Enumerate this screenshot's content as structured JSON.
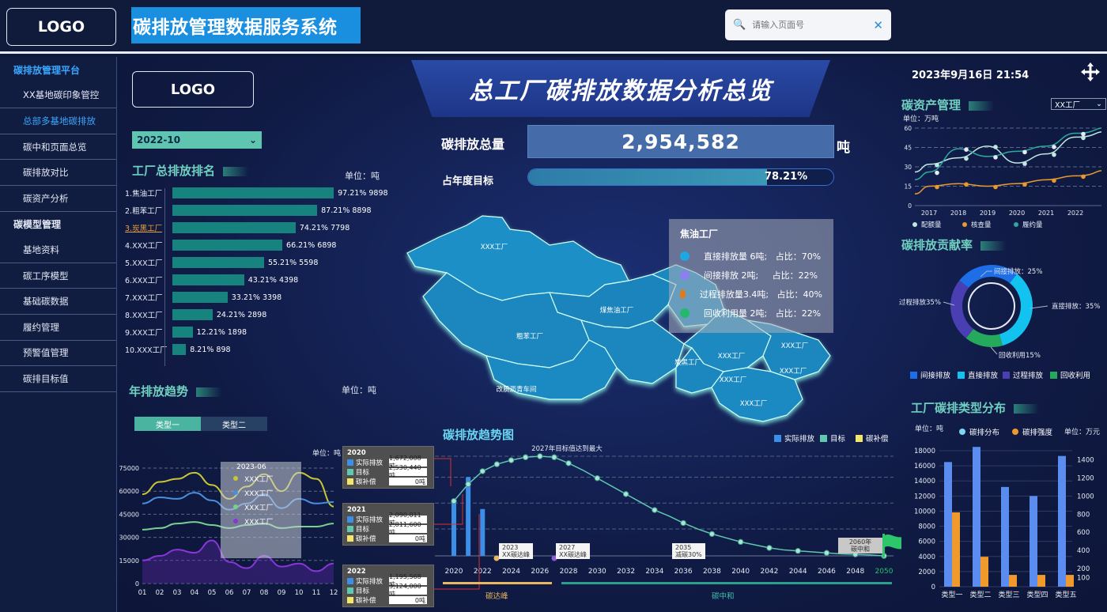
{
  "header": {
    "logo": "LOGO",
    "system_title": "碳排放管理数据服务系统",
    "search_placeholder": "请输入页面号"
  },
  "sidebar": {
    "items": [
      {
        "label": "碳排放管理平台",
        "type": "head-active"
      },
      {
        "label": "XX基地碳印象管控",
        "type": "item"
      },
      {
        "label": "总部多基地碳排放",
        "type": "active"
      },
      {
        "label": "碳中和页面总览",
        "type": "item"
      },
      {
        "label": "碳排放对比",
        "type": "item"
      },
      {
        "label": "碳资产分析",
        "type": "item"
      },
      {
        "label": "碳模型管理",
        "type": "head"
      },
      {
        "label": "基地资料",
        "type": "item"
      },
      {
        "label": "碳工序模型",
        "type": "item"
      },
      {
        "label": "基础碳数据",
        "type": "item"
      },
      {
        "label": "履约管理",
        "type": "item"
      },
      {
        "label": "预警值管理",
        "type": "item"
      },
      {
        "label": "碳排目标值",
        "type": "item"
      }
    ]
  },
  "main": {
    "logo": "LOGO",
    "page_title": "总工厂碳排放数据分析总览",
    "date_select": "2022-10",
    "datetime": "2023年9月16日 21:54",
    "total_label": "碳排放总量",
    "total_value": "2,954,582",
    "total_unit": "吨",
    "target_label": "占年度目标",
    "target_percent_text": "78.21%",
    "target_fraction": 0.7821
  },
  "ranking": {
    "title": "工厂总排放排名",
    "unit": "单位：吨",
    "rows": [
      {
        "name": "1.焦油工厂",
        "percent": 97.21,
        "value": "97.21% 9898",
        "highlight": false
      },
      {
        "name": "2.粗苯工厂",
        "percent": 87.21,
        "value": "87.21% 8898",
        "highlight": false
      },
      {
        "name": "3.炭黑工厂",
        "percent": 74.21,
        "value": "74.21% 7798",
        "highlight": true
      },
      {
        "name": "4.XXX工厂",
        "percent": 66.21,
        "value": "66.21% 6898",
        "highlight": false
      },
      {
        "name": "5.XXX工厂",
        "percent": 55.21,
        "value": "55.21% 5598",
        "highlight": false
      },
      {
        "name": "6.XXX工厂",
        "percent": 43.21,
        "value": "43.21% 4398",
        "highlight": false
      },
      {
        "name": "7.XXX工厂",
        "percent": 33.21,
        "value": "33.21% 3398",
        "highlight": false
      },
      {
        "name": "8.XXX工厂",
        "percent": 24.21,
        "value": "24.21% 2898",
        "highlight": false
      },
      {
        "name": "9.XXX工厂",
        "percent": 12.21,
        "value": "12.21% 1898",
        "highlight": false
      },
      {
        "name": "10.XXX工厂",
        "percent": 8.21,
        "value": "8.21% 898",
        "highlight": false
      }
    ]
  },
  "annual_trend": {
    "title": "年排放趋势",
    "unit": "单位：吨",
    "tabs": [
      "类型一",
      "类型二"
    ],
    "unit_small": "单位：吨",
    "tooltip": {
      "month": "2023-06",
      "items": [
        "XXX工厂",
        "XXX工厂",
        "XXX工厂",
        "XXX工厂"
      ]
    },
    "chart_data": {
      "type": "line",
      "categories": [
        "01",
        "02",
        "03",
        "04",
        "05",
        "06",
        "07",
        "08",
        "09",
        "10",
        "11",
        "12"
      ],
      "yticks": [
        0,
        15000,
        30000,
        45000,
        60000,
        75000
      ],
      "ylim": [
        0,
        75000
      ],
      "series": [
        {
          "color": "#c8c635",
          "values": [
            58000,
            66000,
            68000,
            72000,
            64000,
            55000,
            63000,
            71000,
            60000,
            72000,
            68000,
            50000
          ]
        },
        {
          "color": "#4a8ee0",
          "values": [
            52000,
            56000,
            55000,
            59000,
            54000,
            48000,
            52000,
            58000,
            49000,
            55000,
            52000,
            53000
          ]
        },
        {
          "color": "#78d090",
          "values": [
            35000,
            36000,
            39000,
            40000,
            38000,
            36000,
            38000,
            39000,
            36000,
            37000,
            37000,
            39000
          ]
        },
        {
          "color": "#8a35d8",
          "values": [
            15000,
            18000,
            22000,
            20000,
            28000,
            14000,
            10000,
            18000,
            11000,
            13000,
            8000,
            13000
          ]
        }
      ]
    }
  },
  "map": {
    "regions": [
      "XXX工厂",
      "煤焦油工厂",
      "粗苯工厂",
      "炭黑工厂",
      "改质沥青车间",
      "XXX工厂",
      "XXX工厂",
      "XXX工厂",
      "XXX工厂",
      "XXX工厂"
    ],
    "tooltip": {
      "title": "焦油工厂",
      "rows": [
        {
          "label": "直接排放量 6吨;   占比：70%",
          "color": "#1ea7e0"
        },
        {
          "label": "间接排放 2吨;     占比：22%",
          "color": "#8c7ff0"
        },
        {
          "label": "过程排放量3.4吨;   占比：40%",
          "color": "#e07a1a"
        },
        {
          "label": "回收利用量 2吨;   占比：22%",
          "color": "#25b96d"
        }
      ]
    }
  },
  "trend_chart": {
    "title": "碳排放趋势图",
    "legend": [
      "实际排放",
      "目标",
      "碳补偿"
    ],
    "peak_note": "2027年目标值达到最大",
    "notes": [
      "2023\nXX碳达峰",
      "2027\nXX碳达峰",
      "2035\n减碳30%",
      "2060年\n碳中和"
    ],
    "phase_labels": [
      "碳达峰",
      "碳中和"
    ],
    "year_boxes": [
      {
        "year": "2020",
        "actual": "1,672,008吨",
        "target": "2,530,440吨",
        "comp": "0吨"
      },
      {
        "year": "2021",
        "actual": "2,090,011吨",
        "target": "2,811,600吨",
        "comp": "0吨"
      },
      {
        "year": "2022",
        "actual": "1,195,568吨",
        "target": "3,124,000吨",
        "comp": "0吨"
      }
    ],
    "row_labels": [
      "实际排放",
      "目标",
      "碳补偿"
    ],
    "chart_data": {
      "type": "line",
      "x": [
        2020,
        2021,
        2022,
        2023,
        2024,
        2025,
        2026,
        2027,
        2028,
        2029,
        2030,
        2031,
        2032,
        2033,
        2034,
        2035,
        2036,
        2037,
        2038,
        2039,
        2040,
        2041,
        2042,
        2043,
        2044,
        2045,
        2046,
        2047,
        2048,
        2049,
        2050
      ],
      "xticks": [
        "2020",
        "2022",
        "2024",
        "2026",
        "2028",
        "2030",
        "2032",
        "2034",
        "2036",
        "2038",
        "2040",
        "2042",
        "2044",
        "2046",
        "2048",
        "2050"
      ],
      "target_values": [
        0.55,
        0.72,
        0.85,
        0.92,
        0.96,
        0.99,
        1.0,
        0.99,
        0.93,
        0.86,
        0.78,
        0.7,
        0.62,
        0.54,
        0.46,
        0.4,
        0.33,
        0.27,
        0.22,
        0.18,
        0.14,
        0.11,
        0.08,
        0.06,
        0.05,
        0.04,
        0.03,
        0.02,
        0.015,
        0.01,
        0.0
      ],
      "actual_bars": [
        {
          "year": 2020,
          "value": 0.53
        },
        {
          "year": 2021,
          "value": 0.79
        },
        {
          "year": 2022,
          "value": 0.47
        }
      ]
    }
  },
  "assets": {
    "title": "碳资产管理",
    "unit": "单位：万吨",
    "select": "XX工厂",
    "legend": [
      "配额量",
      "核查量",
      "履约量"
    ],
    "chart_data": {
      "type": "line",
      "x": [
        "2017",
        "2018",
        "2019",
        "2020",
        "2021",
        "2022"
      ],
      "yticks": [
        0,
        15,
        30,
        45,
        60
      ],
      "ylim": [
        0,
        60
      ],
      "series": [
        {
          "name": "配额量",
          "color": "#bfe8e0",
          "values": [
            32,
            37,
            46,
            33,
            40,
            53
          ]
        },
        {
          "name": "核查量",
          "color": "#e89a2e",
          "values": [
            15,
            17,
            15,
            17,
            20,
            23
          ]
        },
        {
          "name": "履约量",
          "color": "#2ea89e",
          "values": [
            26,
            44,
            38,
            42,
            46,
            56
          ]
        }
      ]
    }
  },
  "contribution": {
    "title": "碳排放贡献率",
    "labels": [
      "间接排放：25%",
      "直接排放：35%",
      "回收利用15%",
      "过程排放35%"
    ],
    "legend": [
      "间接排放",
      "直接排放",
      "过程排放",
      "回收利用"
    ],
    "chart_data": {
      "type": "pie",
      "slices": [
        {
          "name": "间接排放",
          "value": 25,
          "color": "#1e6ee8"
        },
        {
          "name": "直接排放",
          "value": 35,
          "color": "#12c3f0"
        },
        {
          "name": "回收利用",
          "value": 15,
          "color": "#25a95d"
        },
        {
          "name": "过程排放",
          "value": 25,
          "color": "#4a3fb2"
        }
      ]
    }
  },
  "types": {
    "title": "工厂碳排类型分布",
    "unit_left": "单位：吨",
    "unit_right": "单位：万元",
    "legend": [
      "碳排分布",
      "碳排强度"
    ],
    "chart_data": {
      "type": "bar",
      "categories": [
        "类型一",
        "类型二",
        "类型三",
        "类型四",
        "类型五"
      ],
      "yticks_left": [
        0,
        2000,
        4000,
        6000,
        8000,
        10000,
        12000,
        14000,
        16000,
        18000
      ],
      "yticks_right": [
        100,
        200,
        400,
        600,
        800,
        1000,
        1200,
        1400
      ],
      "series": [
        {
          "name": "碳排分布",
          "color": "#5b8cf0",
          "values": [
            16500,
            18500,
            13200,
            12000,
            17300
          ]
        },
        {
          "name": "碳排强度",
          "color": "#f09a2e",
          "values": [
            820,
            330,
            130,
            130,
            130
          ]
        }
      ]
    }
  }
}
